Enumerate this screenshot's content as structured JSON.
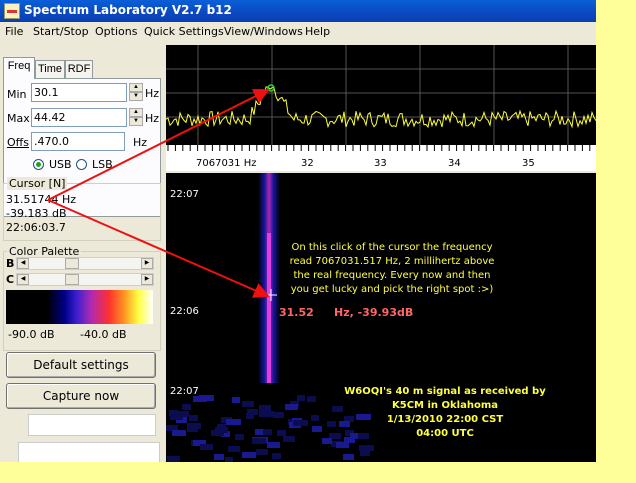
{
  "window": {
    "title": "Spectrum Laboratory V2.7 b12"
  },
  "menu": [
    "File",
    "Start/Stop",
    "Options",
    "Quick Settings",
    "View/Windows",
    "Help"
  ],
  "tabs": [
    "Freq",
    "Time",
    "RDF"
  ],
  "freq": {
    "min_label": "Min",
    "min_value": "30.1",
    "min_unit": "Hz",
    "max_label": "Max",
    "max_value": "44.42",
    "max_unit": "Hz",
    "offs_label": "Offs",
    "offs_value": ".470.0",
    "offs_unit": "Hz",
    "usb_label": "USB",
    "lsb_label": "LSB"
  },
  "cursor": {
    "title": "Cursor [N]",
    "freq": "31.51744 Hz",
    "level": "-39.183 dB",
    "time": "22:06:03.7"
  },
  "palette": {
    "title": "Color Palette",
    "b_label": "B",
    "c_label": "C",
    "min_label": "-90.0 dB",
    "max_label": "-40.0 dB"
  },
  "buttons": {
    "default": "Default settings",
    "capture": "Capture now"
  },
  "scale": {
    "first": "7067031 Hz",
    "t32": "32",
    "t33": "33",
    "t34": "34",
    "t35": "35"
  },
  "waterfall": {
    "times": [
      "22:07",
      "22:06",
      "22:07"
    ],
    "annotation1": [
      "On this click of the cursor the frequency",
      "read 7067031.517 Hz, 2 millihertz above",
      "the real frequency. Every now and then",
      "you get lucky and pick the right spot :>)"
    ],
    "readout_freq": "31.52",
    "readout_rest": "Hz, -39.93dB",
    "annotation2": [
      "W6OQI's 40 m signal as received by",
      "K5CM in Oklahoma",
      "1/13/2010 22:00 CST",
      "04:00 UTC"
    ]
  },
  "colors": {
    "arrow": "#ee1111",
    "trace": "#ffff33",
    "annotation": "#ffff44",
    "readout": "#ff6666"
  }
}
